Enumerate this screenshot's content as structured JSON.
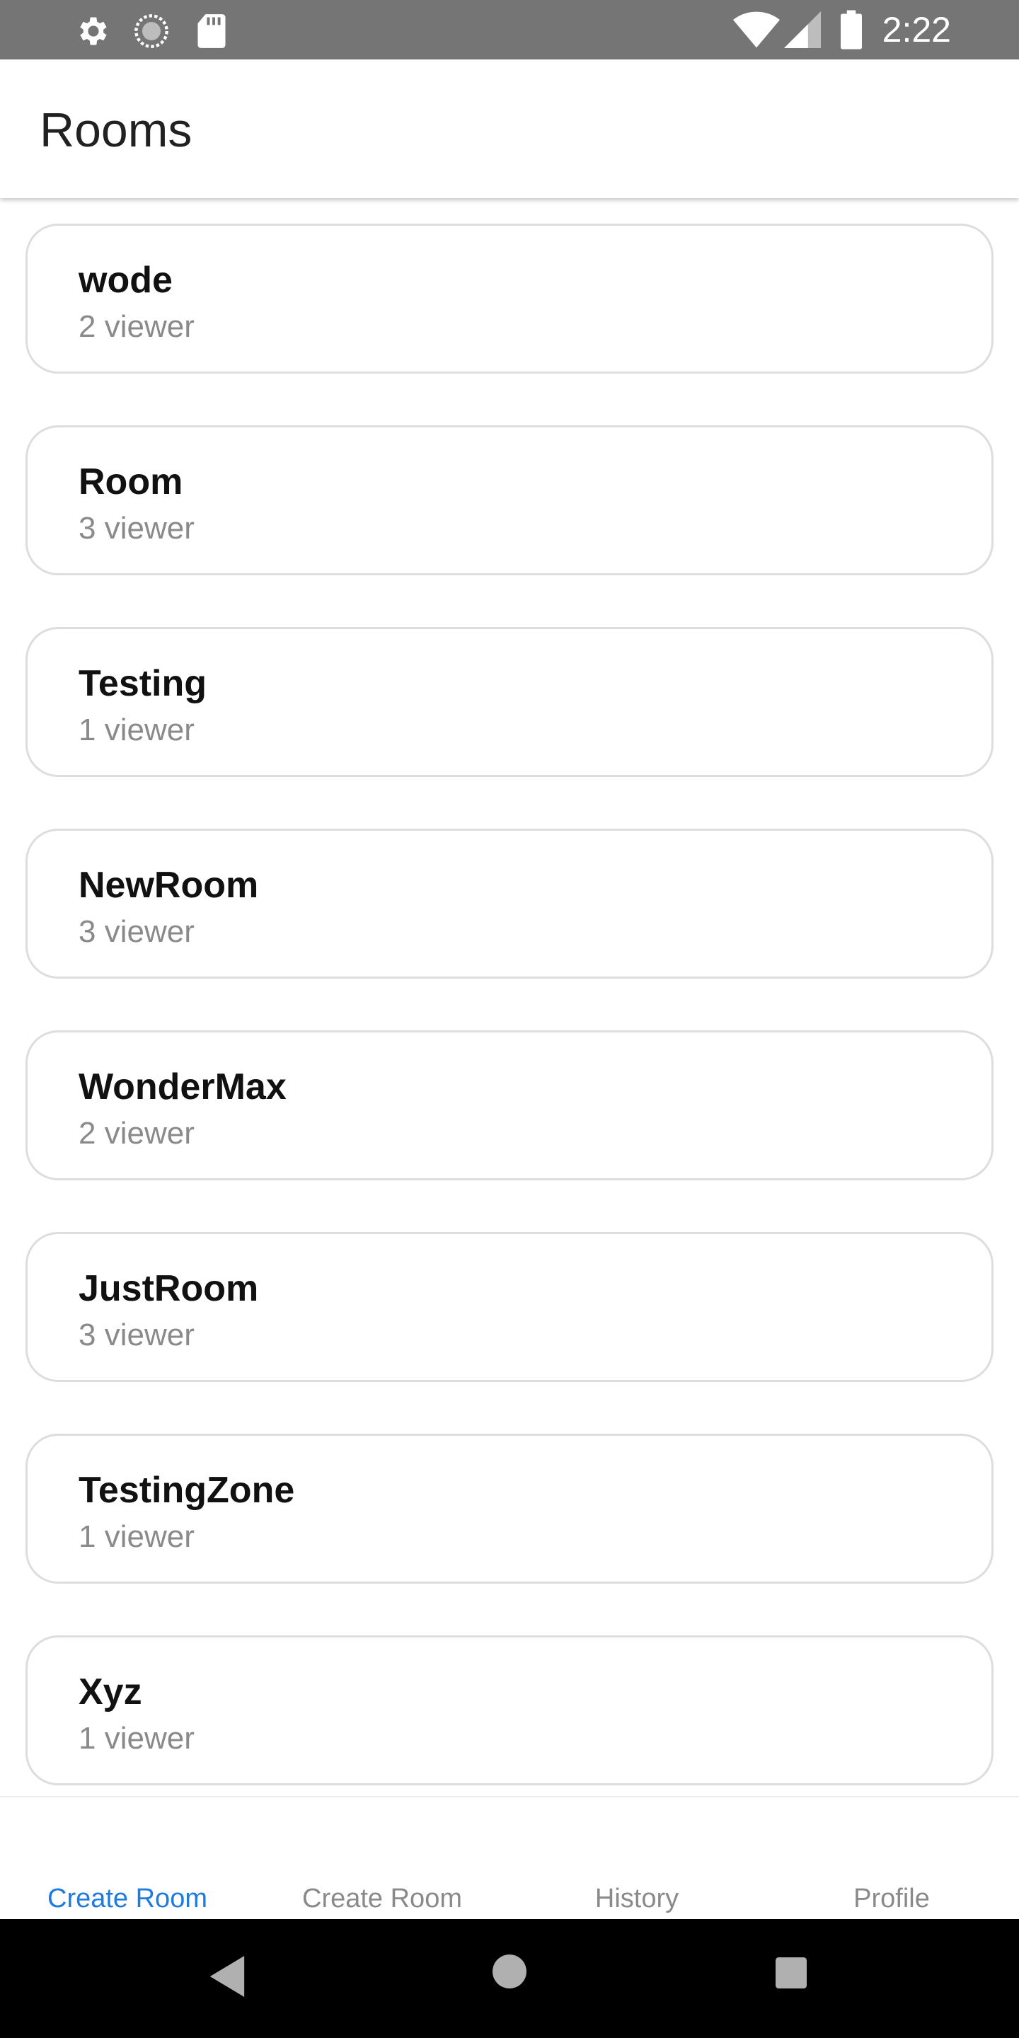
{
  "status_bar": {
    "time": "2:22",
    "left_icons": [
      "settings-icon",
      "sync-icon",
      "sd-card-icon"
    ],
    "right_icons": [
      "wifi-icon",
      "cell-signal-icon",
      "battery-icon"
    ],
    "background": "#757575"
  },
  "app_bar": {
    "title": "Rooms"
  },
  "rooms": [
    {
      "name": "wode",
      "viewers": "2 viewer"
    },
    {
      "name": "Room",
      "viewers": "3 viewer"
    },
    {
      "name": "Testing",
      "viewers": "1 viewer"
    },
    {
      "name": "NewRoom",
      "viewers": "3 viewer"
    },
    {
      "name": "WonderMax",
      "viewers": "2 viewer"
    },
    {
      "name": "JustRoom",
      "viewers": "3 viewer"
    },
    {
      "name": "TestingZone",
      "viewers": "1 viewer"
    },
    {
      "name": "Xyz",
      "viewers": "1 viewer"
    }
  ],
  "bottom_nav": {
    "tabs": [
      {
        "label": "Create Room",
        "active": true
      },
      {
        "label": "Create Room",
        "active": false
      },
      {
        "label": "History",
        "active": false
      },
      {
        "label": "Profile",
        "active": false
      }
    ],
    "active_color": "#1e7be0",
    "inactive_color": "#8a8a8a"
  },
  "system_nav": {
    "buttons": [
      "back-icon",
      "home-icon",
      "recents-icon"
    ]
  }
}
